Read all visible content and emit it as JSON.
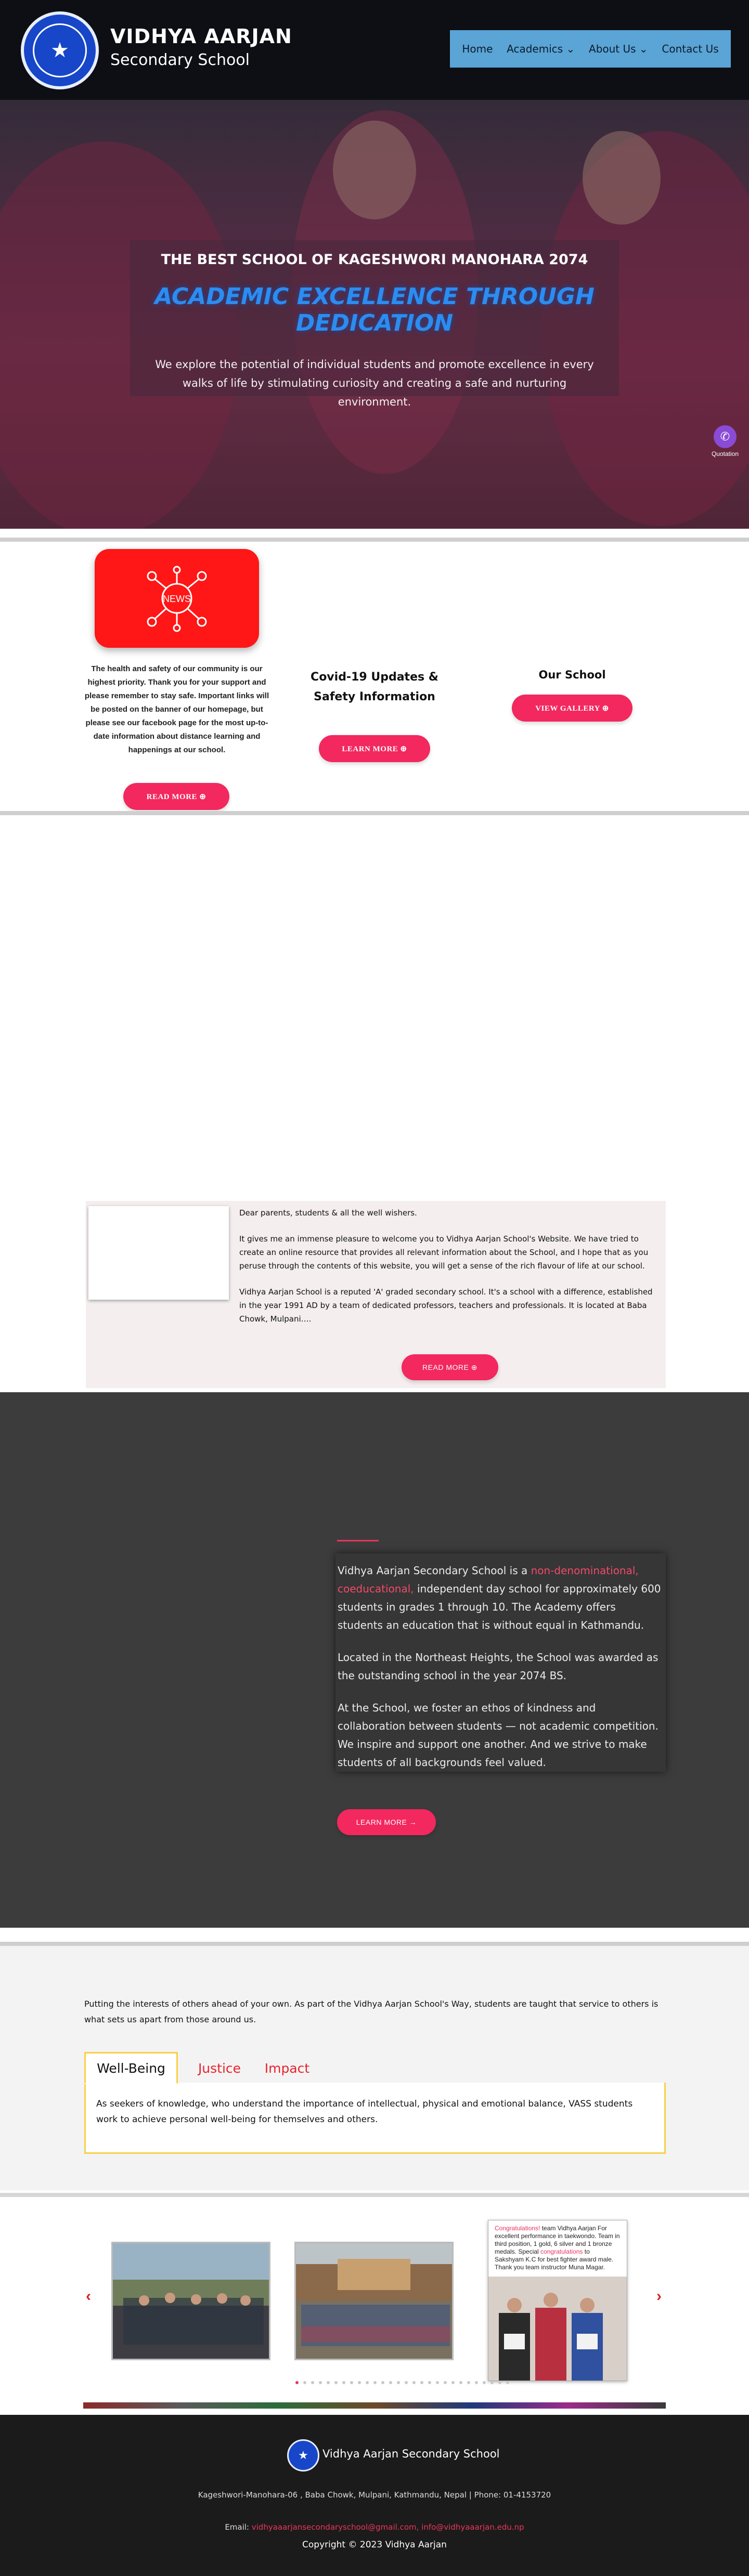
{
  "header": {
    "name_line1": "VIDHYA AARJAN",
    "name_line2": "Secondary School",
    "nav": [
      {
        "label": "Home"
      },
      {
        "label": "Academics ⌄"
      },
      {
        "label": "About Us ⌄"
      },
      {
        "label": "Contact Us"
      }
    ]
  },
  "hero": {
    "kicker": "THE BEST SCHOOL OF KAGESHWORI MANOHARA 2074",
    "title": "ACADEMIC EXCELLENCE THROUGH DEDICATION",
    "text": "We explore the potential of individual students and promote excellence in every walks of life by stimulating curiosity and creating a safe and nurturing environment.",
    "quotation_label": "Quotation"
  },
  "features": {
    "news_card_label": "NEWS",
    "news_text": "The health and safety of our community is our highest priority. Thank you for your support and please remember to stay safe. Important links will be posted on the banner of our homepage, but please see our facebook page for the most up-to-date information about distance learning and happenings at our school.",
    "news_button": "READ MORE ⊕",
    "covid_title": "Covid-19 Updates & Safety Information",
    "covid_button": "LEARN MORE ⊕",
    "school_title": "Our School",
    "school_button": "VIEW GALLERY ⊕"
  },
  "welcome": {
    "p1": "Dear parents, students & all the well wishers.",
    "p2": "It gives me an immense pleasure to welcome you to Vidhya Aarjan School's Website. We have tried to create an online resource that provides all relevant information about the School, and I hope that as you peruse through the contents of this website, you will get a sense of the rich flavour of life at our school.",
    "p3": "Vidhya Aarjan School is a reputed 'A' graded secondary school. It's a school with a difference, established in the year 1991 AD by a team of dedicated professors, teachers and professionals. It is located at Baba Chowk, Mulpani….",
    "button": "READ MORE ⊕"
  },
  "about": {
    "p1_a": "Vidhya Aarjan Secondary School is a ",
    "p1_hl": "non-denominational, coeducational,",
    "p1_b": " independent day school for approximately 600 students in grades 1 through 10. The Academy offers students an education that is without equal in Kathmandu.",
    "p2": "Located in the Northeast Heights, the School was awarded as the outstanding school in the year 2074 BS.",
    "p3": "At the School, we foster an ethos of kindness and collaboration between students — not academic competition. We inspire and support one another. And we strive to make students of all backgrounds feel valued.",
    "button": "LEARN MORE →"
  },
  "values": {
    "intro": "Putting the interests of others ahead of your own. As part of the Vidhya Aarjan School's Way, students are taught that service to others is what sets us apart from those around us.",
    "tabs": [
      {
        "label": "Well-Being"
      },
      {
        "label": "Justice"
      },
      {
        "label": "Impact"
      }
    ],
    "panel": "As seekers of knowledge, who understand the importance of intellectual, physical and emotional balance, VASS students work to achieve personal well-being for themselves and others."
  },
  "carousel": {
    "prev": "‹",
    "next": "›",
    "post_hl1": "Congratulations!",
    "post_a": " team Vidhya Aarjan For excellent performance in taekwondo. Team in third position, 1 gold, 6 silver and 1 bronze medals. Special ",
    "post_hl2": "congratulations",
    "post_b": " to Sakshyam K.C for best fighter award male. Thank you team instructor Muna Magar."
  },
  "footer": {
    "name": "Vidhya Aarjan Secondary School",
    "address": "Kageshwori-Manohara-06 , Baba Chowk, Mulpani, Kathmandu, Nepal | Phone: 01-4153720",
    "email_label": "Email: ",
    "email": "vidhyaaarjansecondaryschool@gmail.com, info@vidhyaaarjan.edu.np",
    "copyright": "Copyright © 2023 Vidhya Aarjan"
  },
  "colors": {
    "accent": "#f2285f",
    "nav_bg": "#5aa4d6",
    "hero_title": "#2c8cf0",
    "tab_border": "#f7d148"
  }
}
